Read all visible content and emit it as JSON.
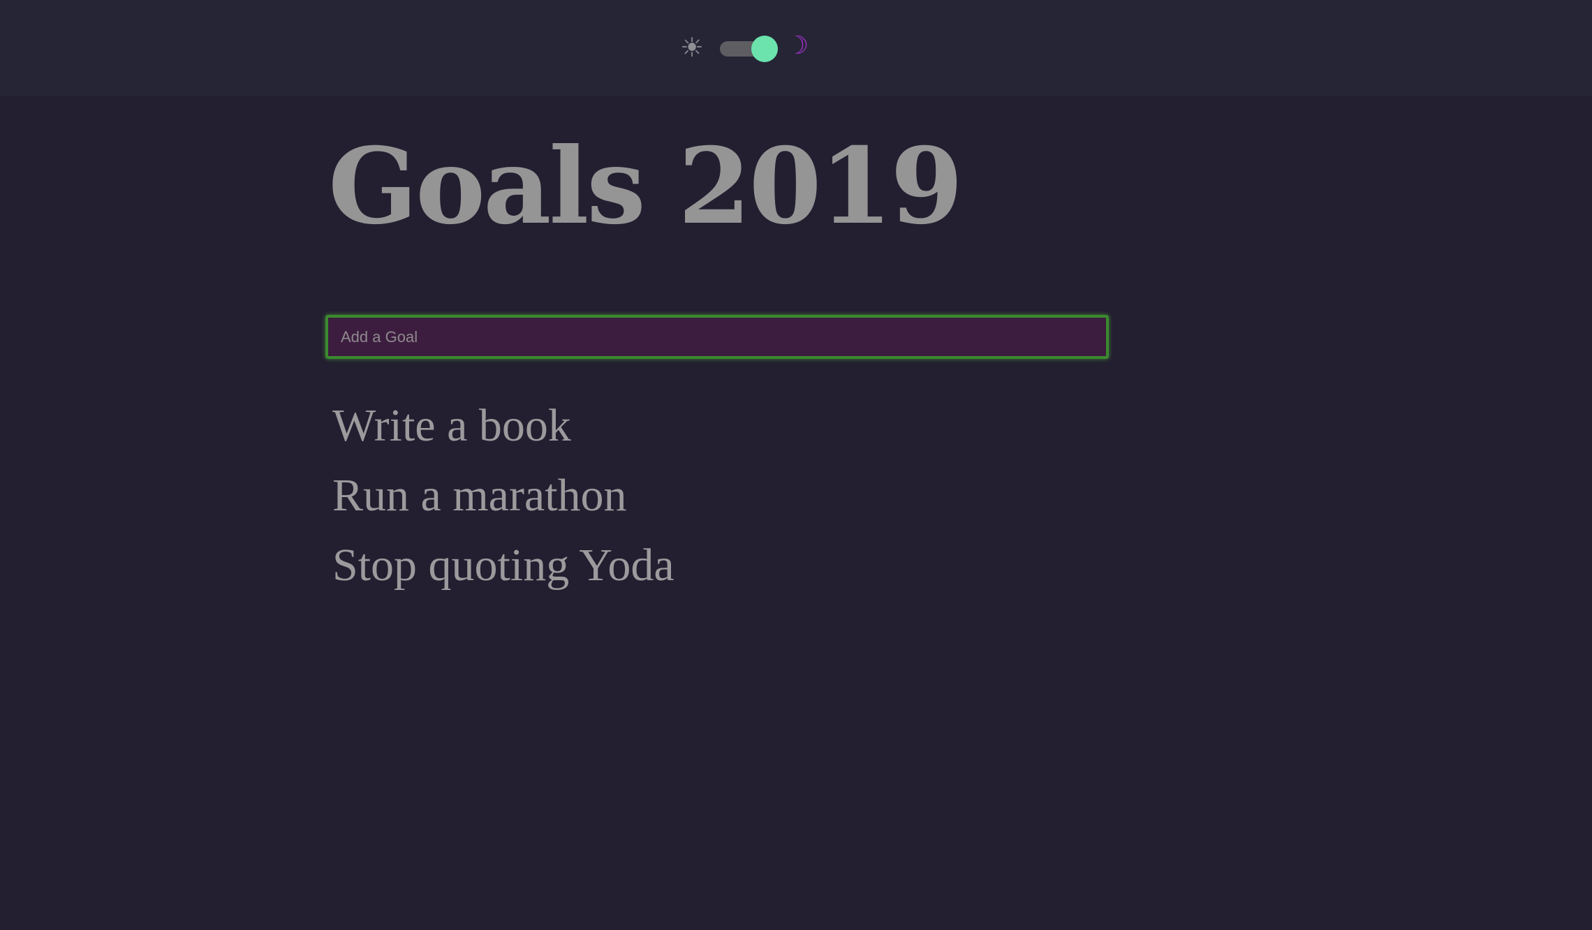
{
  "header": {
    "theme_toggle": {
      "light_icon": "sun-icon",
      "light_glyph": "☀",
      "dark_icon": "moon-icon",
      "dark_glyph": "☽",
      "state": "dark"
    }
  },
  "main": {
    "title": "Goals 2019",
    "input": {
      "placeholder": "Add a Goal",
      "value": ""
    },
    "goals": [
      "Write a book",
      "Run a marathon",
      "Stop quoting Yoda"
    ]
  },
  "colors": {
    "background": "#231e30",
    "topbar": "#262536",
    "toggle_knob": "#6ce3ad",
    "moon": "#a032c8",
    "input_border": "#3b8a2f",
    "input_background": "#3d1d3f",
    "text": "#959595"
  }
}
